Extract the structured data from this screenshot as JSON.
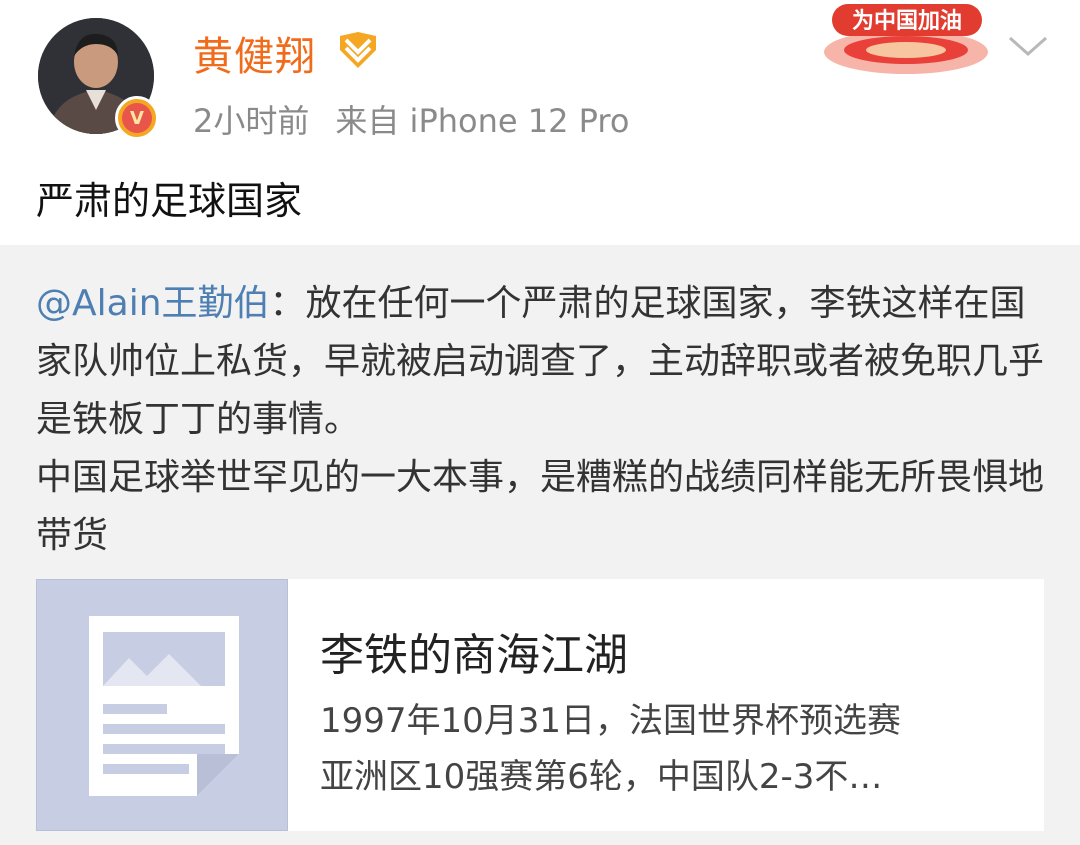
{
  "post": {
    "username": "黄健翔",
    "time": "2小时前",
    "source": "来自 iPhone 12 Pro",
    "text": "严肃的足球国家",
    "banner_text": "为中国加油",
    "verified_mark": "V"
  },
  "repost": {
    "mention": "@Alain王勤伯",
    "separator": "：",
    "body": "放在任何一个严肃的足球国家，李铁这样在国家队帅位上私货，早就被启动调查了，主动辞职或者被免职几乎是铁板丁丁的事情。",
    "body2": "中国足球举世罕见的一大本事，是糟糕的战绩同样能无所畏惧地带货"
  },
  "link_card": {
    "title": "李铁的商海江湖",
    "desc_line1": "1997年10月31日，法国世界杯预选赛",
    "desc_line2": "亚洲区10强赛第6轮，中国队2-3不…"
  },
  "icons": {
    "rank": "rank-badge-icon",
    "more": "chevron-down-icon",
    "thumbnail": "article-placeholder-icon"
  },
  "colors": {
    "username": "#f06b1a",
    "mention": "#4e7fb3",
    "meta": "#8a8a8a",
    "repost_bg": "#f2f2f2",
    "thumb_bg": "#c7cde3"
  }
}
